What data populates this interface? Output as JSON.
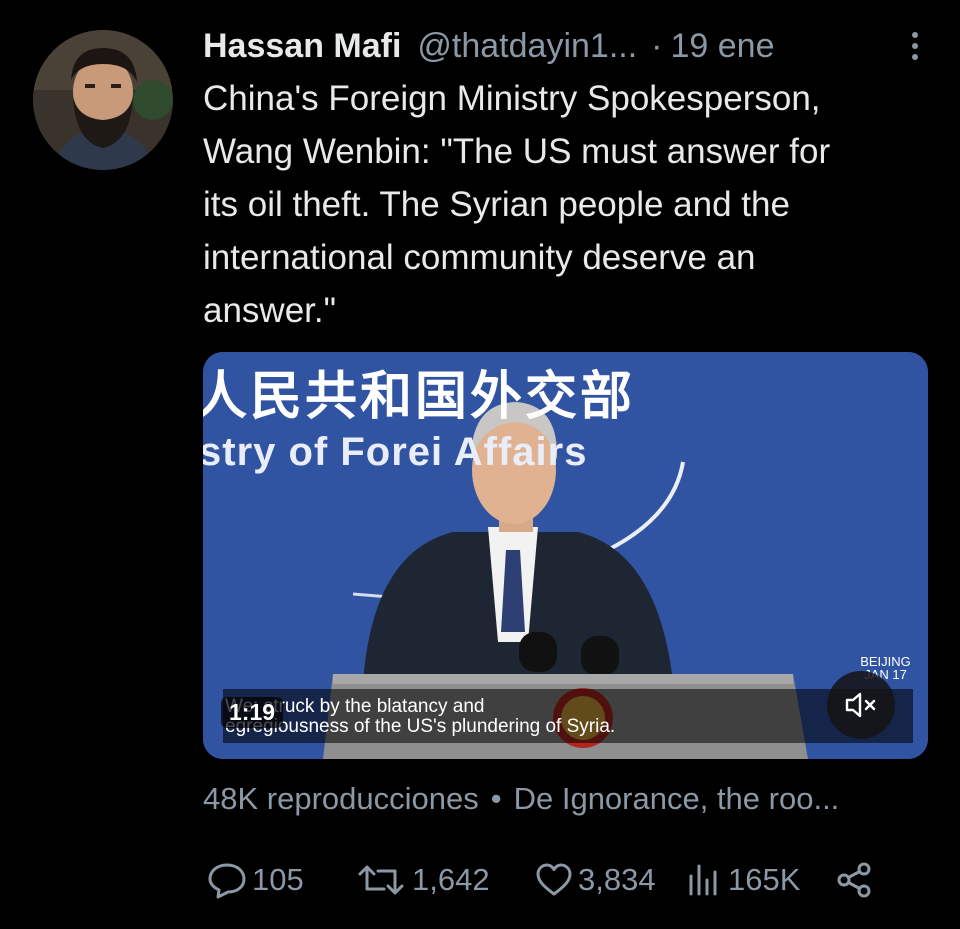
{
  "tweet": {
    "author_name": "Hassan Mafi",
    "author_handle": "@thatdayin1...",
    "dot": "·",
    "date": "19 ene",
    "text": "China's Foreign Ministry Spokesperson,\nWang Wenbin: \"The US must answer for\nits oil theft. The Syrian people and the\ninternational community deserve an\nanswer.\""
  },
  "media": {
    "backdrop_cn": "人民共和国外交部",
    "backdrop_en": "stry of Forei    Affairs",
    "location": "BEIJING",
    "location_date": "JAN 17",
    "caption": "We: struck by the blatancy and\negregiousness of the US's plundering of Syria.",
    "timestamp": "1:19"
  },
  "meta": {
    "views": "48K reproducciones",
    "separator": "•",
    "source": "De Ignorance, the roo..."
  },
  "actions": {
    "replies": "105",
    "retweets": "1,642",
    "likes": "3,834",
    "views": "165K"
  },
  "colors": {
    "background": "#000000",
    "text": "#e7e9ea",
    "secondary": "#8b98a5",
    "media_backdrop": "#3357a8"
  }
}
